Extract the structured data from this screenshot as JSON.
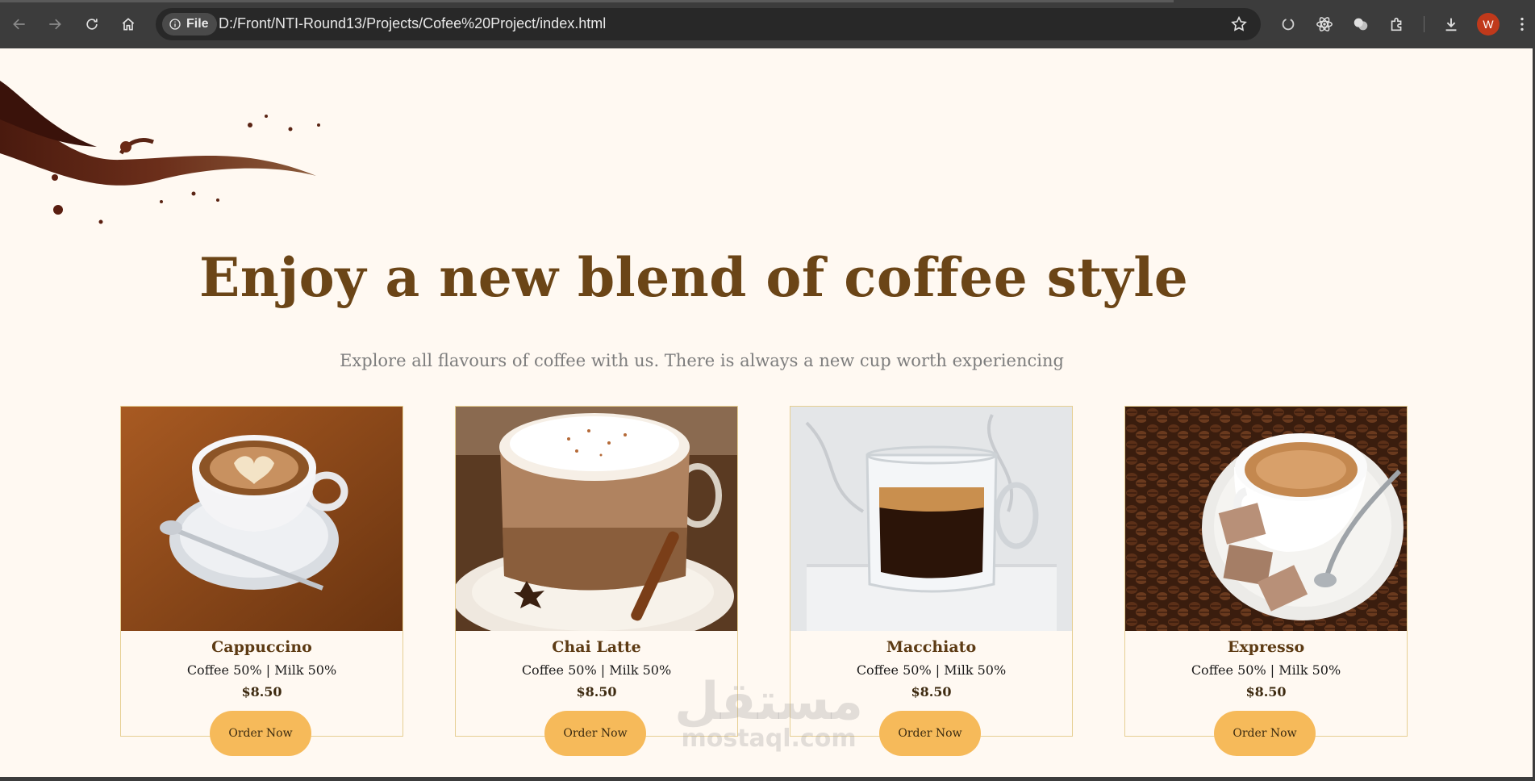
{
  "browser": {
    "file_chip_label": "File",
    "url": "D:/Front/NTI-Round13/Projects/Cofee%20Project/index.html",
    "avatar_letter": "W"
  },
  "hero": {
    "title": "Enjoy a new blend of coffee style",
    "subtitle": "Explore all flavours of coffee with us. There is always a new cup worth experiencing"
  },
  "cards": [
    {
      "name": "Cappuccino",
      "ratio": "Coffee 50% | Milk 50%",
      "price": "$8.50",
      "button": "Order Now"
    },
    {
      "name": "Chai Latte",
      "ratio": "Coffee 50% | Milk 50%",
      "price": "$8.50",
      "button": "Order Now"
    },
    {
      "name": "Macchiato",
      "ratio": "Coffee 50% | Milk 50%",
      "price": "$8.50",
      "button": "Order Now"
    },
    {
      "name": "Expresso",
      "ratio": "Coffee 50% | Milk 50%",
      "price": "$8.50",
      "button": "Order Now"
    }
  ],
  "watermark": {
    "arabic": "مستقل",
    "latin": "mostaql.com"
  },
  "colors": {
    "page_bg": "#fff9f2",
    "title_brown": "#6b4517",
    "button_orange": "#f6ba5a",
    "card_border": "#e6cf93"
  }
}
